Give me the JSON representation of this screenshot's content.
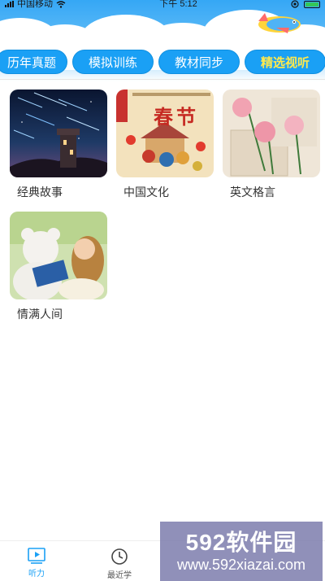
{
  "status_bar": {
    "carrier": "中国移动",
    "time": "下午 5:12"
  },
  "top_tabs": [
    {
      "label": "历年真题",
      "active": false
    },
    {
      "label": "模拟训练",
      "active": false
    },
    {
      "label": "教材同步",
      "active": false
    },
    {
      "label": "精选视听",
      "active": true
    }
  ],
  "cards": [
    {
      "label": "经典故事",
      "image": "night-castle-meteor-image"
    },
    {
      "label": "中国文化",
      "image": "spring-festival-poster-image",
      "poster_text": "春节"
    },
    {
      "label": "英文格言",
      "image": "carnation-flowers-image"
    },
    {
      "label": "情满人间",
      "image": "girl-teddy-bear-image"
    }
  ],
  "bottom_tabs": [
    {
      "label": "听力",
      "icon": "play-square-icon",
      "active": true
    },
    {
      "label": "最近学",
      "icon": "clock-icon",
      "active": false
    }
  ],
  "watermark": {
    "brand": "592软件园",
    "url": "www.592xiazai.com"
  },
  "colors": {
    "accent": "#1aa0f5",
    "active_tab_text": "#ffe94d"
  }
}
